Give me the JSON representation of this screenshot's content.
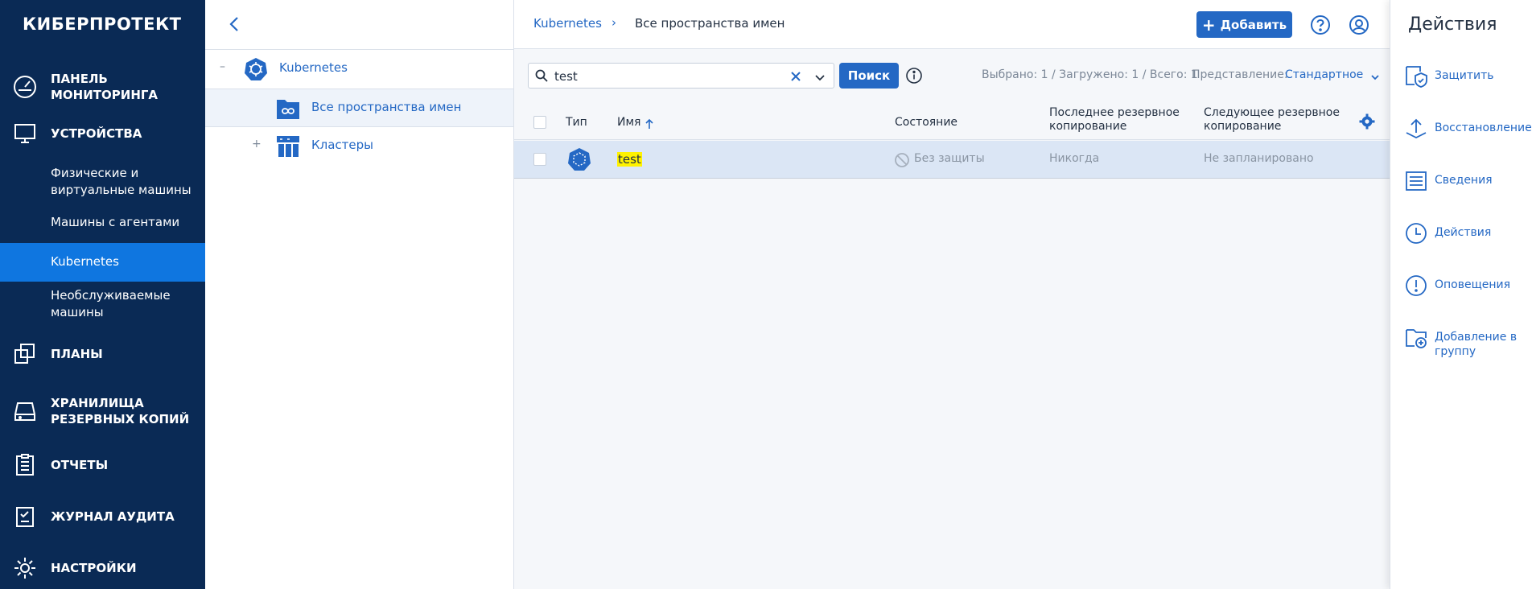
{
  "nav": {
    "brand": "КИБЕРПРОТЕКТ",
    "items": [
      {
        "label": "ПАНЕЛЬ\nМОНИТОРИНГА",
        "icon": "dashboard-icon"
      },
      {
        "label": "УСТРОЙСТВА",
        "icon": "monitor-icon"
      },
      {
        "label": "ПЛАНЫ",
        "icon": "plans-icon"
      },
      {
        "label": "ХРАНИЛИЩА\nРЕЗЕРВНЫХ КОПИЙ",
        "icon": "storage-icon"
      },
      {
        "label": "ОТЧЕТЫ",
        "icon": "reports-icon"
      },
      {
        "label": "ЖУРНАЛ АУДИТА",
        "icon": "audit-icon"
      },
      {
        "label": "НАСТРОЙКИ",
        "icon": "gear-icon"
      }
    ],
    "sub_items": [
      {
        "label": "Физические и\nвиртуальные машины"
      },
      {
        "label": "Машины с агентами"
      },
      {
        "label": "Kubernetes",
        "active": true
      },
      {
        "label": "Необслуживаемые\nмашины"
      }
    ]
  },
  "tree": {
    "root": {
      "label": "Kubernetes",
      "toggle": "–",
      "icon": "kubernetes-icon"
    },
    "children": [
      {
        "label": "Все пространства имен",
        "icon": "namespaces-icon",
        "selected": true
      },
      {
        "label": "Кластеры",
        "toggle": "+",
        "icon": "clusters-icon"
      }
    ]
  },
  "header": {
    "breadcrumb_root": "Kubernetes",
    "breadcrumb_sep": "›",
    "breadcrumb_current": "Все пространства имен",
    "add_label": "Добавить"
  },
  "toolbar": {
    "search_value": "test",
    "search_button": "Поиск",
    "stats": "Выбрано: 1 / Загружено: 1 / Всего: 1",
    "view_label": "Представление:",
    "view_value": "Стандартное"
  },
  "table": {
    "headers": {
      "type": "Тип",
      "name": "Имя",
      "status": "Состояние",
      "last_backup": "Последнее резервное\nкопирование",
      "next_backup": "Следующее резервное\nкопирование"
    },
    "rows": [
      {
        "name": "test",
        "status": "Без защиты",
        "last_backup": "Никогда",
        "next_backup": "Не запланировано"
      }
    ]
  },
  "actions": {
    "title": "Действия",
    "items": [
      {
        "label": "Защитить",
        "icon": "shield-icon"
      },
      {
        "label": "Восстановление",
        "icon": "restore-icon"
      },
      {
        "label": "Сведения",
        "icon": "details-icon"
      },
      {
        "label": "Действия",
        "icon": "clock-icon"
      },
      {
        "label": "Оповещения",
        "icon": "alert-icon"
      },
      {
        "label": "Добавление в\nгруппу",
        "icon": "add-to-group-icon"
      }
    ]
  },
  "colors": {
    "nav_bg": "#0a2a55",
    "nav_active": "#0f76e0",
    "accent": "#2468c4",
    "row_selected": "#dbe6f5",
    "highlight": "#fff200"
  }
}
